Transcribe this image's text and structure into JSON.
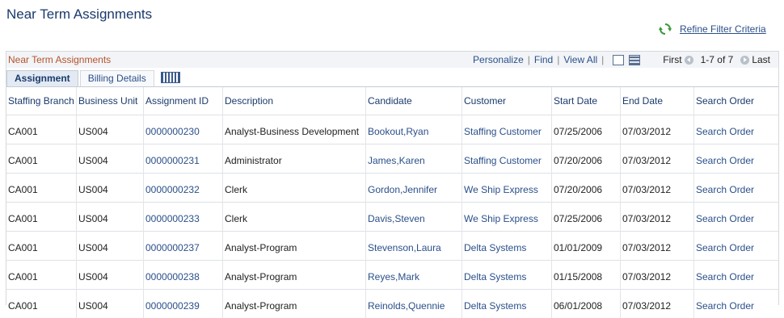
{
  "page": {
    "title": "Near Term Assignments"
  },
  "refine": {
    "label": "Refine Filter Criteria",
    "icon": "refresh-icon"
  },
  "grid": {
    "title": "Near Term Assignments",
    "nav": {
      "personalize": "Personalize",
      "find": "Find",
      "view_all": "View All",
      "first": "First",
      "range": "1-7 of 7",
      "last": "Last"
    },
    "tabs": [
      {
        "label": "Assignment",
        "active": true
      },
      {
        "label": "Billing Details",
        "active": false
      }
    ],
    "columns": [
      "Staffing Branch",
      "Business Unit",
      "Assignment ID",
      "Description",
      "Candidate",
      "Customer",
      "Start Date",
      "End Date",
      "Search Order"
    ],
    "rows": [
      [
        "CA001",
        "US004",
        "0000000230",
        "Analyst-Business Development",
        "Bookout,Ryan",
        "Staffing Customer",
        "07/25/2006",
        "07/03/2012",
        "Search Order"
      ],
      [
        "CA001",
        "US004",
        "0000000231",
        "Administrator",
        "James,Karen",
        "Staffing Customer",
        "07/20/2006",
        "07/03/2012",
        "Search Order"
      ],
      [
        "CA001",
        "US004",
        "0000000232",
        "Clerk",
        "Gordon,Jennifer",
        "We Ship Express",
        "07/20/2006",
        "07/03/2012",
        "Search Order"
      ],
      [
        "CA001",
        "US004",
        "0000000233",
        "Clerk",
        "Davis,Steven",
        "We Ship Express",
        "07/25/2006",
        "07/03/2012",
        "Search Order"
      ],
      [
        "CA001",
        "US004",
        "0000000237",
        "Analyst-Program",
        "Stevenson,Laura",
        "Delta Systems",
        "01/01/2009",
        "07/03/2012",
        "Search Order"
      ],
      [
        "CA001",
        "US004",
        "0000000238",
        "Analyst-Program",
        "Reyes,Mark",
        "Delta Systems",
        "01/15/2008",
        "07/03/2012",
        "Search Order"
      ],
      [
        "CA001",
        "US004",
        "0000000239",
        "Analyst-Program",
        "Reinolds,Quennie",
        "Delta Systems",
        "06/01/2008",
        "07/03/2012",
        "Search Order"
      ]
    ]
  },
  "colors": {
    "title": "#1a3a6b",
    "link": "#2a4f8a",
    "grid_title": "#b5532c",
    "header_bg": "#f2f4f7"
  }
}
